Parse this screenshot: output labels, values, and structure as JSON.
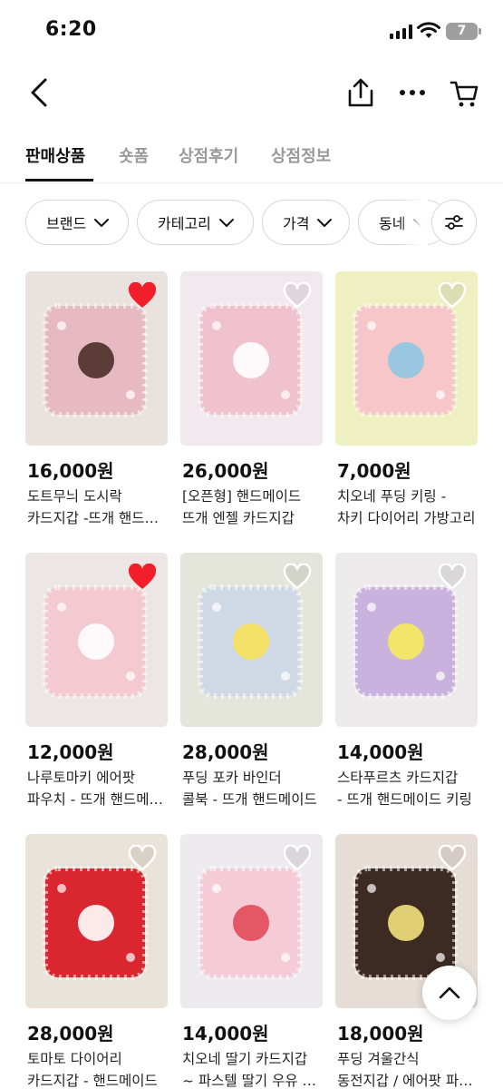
{
  "status_bar": {
    "time": "6:20",
    "battery": "7",
    "icons": [
      "signal-icon",
      "wifi-icon",
      "battery-icon"
    ]
  },
  "nav": {
    "icons": [
      "back-icon",
      "share-icon",
      "more-icon",
      "cart-icon"
    ]
  },
  "tabs": [
    {
      "label": "판매상품",
      "active": true
    },
    {
      "label": "숏폼",
      "active": false
    },
    {
      "label": "상점후기",
      "active": false
    },
    {
      "label": "상점정보",
      "active": false
    }
  ],
  "filters": [
    {
      "label": "브랜드"
    },
    {
      "label": "카테고리"
    },
    {
      "label": "가격"
    },
    {
      "label": "동네"
    }
  ],
  "filter_settings_icon": "sliders-icon",
  "products": [
    {
      "price": "16,000원",
      "title_line1": "도트무늬 도시락",
      "title_line2": "카드지갑 -뜨개 핸드메이드",
      "liked": true,
      "colors": [
        "#e9e2df",
        "#e7b9c2",
        "#4d2f27"
      ]
    },
    {
      "price": "26,000원",
      "title_line1": "[오픈형] 핸드메이드",
      "title_line2": "뜨개 엔젤 카드지갑",
      "liked": false,
      "colors": [
        "#f1e9ee",
        "#f0c2cd",
        "#ffffff"
      ]
    },
    {
      "price": "7,000원",
      "title_line1": "치오네 푸딩 키링 -",
      "title_line2": "차키 다이어리 가방고리",
      "liked": false,
      "colors": [
        "#eef0c2",
        "#f7c6c9",
        "#8fc6e2"
      ]
    },
    {
      "price": "12,000원",
      "title_line1": "나루토마키 에어팟",
      "title_line2": "파우치 - 뜨개 핸드메이드",
      "liked": true,
      "colors": [
        "#ece7e5",
        "#f4c9d2",
        "#ffffff"
      ]
    },
    {
      "price": "28,000원",
      "title_line1": "푸딩 포카 바인더",
      "title_line2": "콜북 - 뜨개 핸드메이드",
      "liked": false,
      "colors": [
        "#e4e6dc",
        "#cfd9e6",
        "#f6e15a"
      ]
    },
    {
      "price": "14,000원",
      "title_line1": "스타푸르츠 카드지갑",
      "title_line2": "- 뜨개 핸드메이드 키링",
      "liked": false,
      "colors": [
        "#eceaea",
        "#c9b3de",
        "#f7ea5c"
      ]
    },
    {
      "price": "28,000원",
      "title_line1": "토마토 다이어리",
      "title_line2": "카드지갑 - 핸드메이드",
      "liked": false,
      "colors": [
        "#eae3d9",
        "#d9262f",
        "#ffffff"
      ]
    },
    {
      "price": "14,000원",
      "title_line1": "치오네 딸기 카드지갑",
      "title_line2": "~ 파스텔 딸기 우유 핑크",
      "liked": false,
      "colors": [
        "#eceaee",
        "#f4cbd6",
        "#e44a5a"
      ]
    },
    {
      "price": "18,000원",
      "title_line1": "푸딩 겨울간식",
      "title_line2": "동전지갑 / 에어팟 파우치",
      "liked": false,
      "colors": [
        "#e6ddd6",
        "#3d2a22",
        "#f3e27c"
      ]
    }
  ],
  "scroll_top_icon": "chevron-up-icon"
}
